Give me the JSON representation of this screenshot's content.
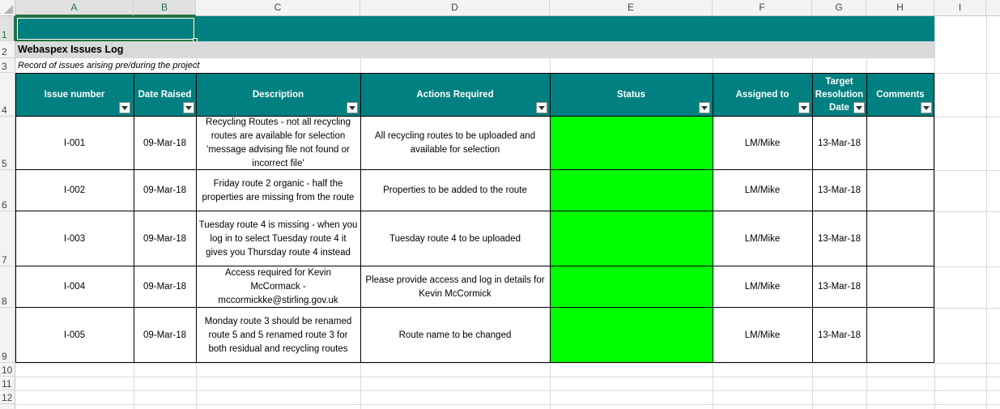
{
  "columns": [
    "A",
    "B",
    "C",
    "D",
    "E",
    "F",
    "G",
    "H",
    "I"
  ],
  "rows": [
    "1",
    "2",
    "3",
    "4",
    "5",
    "6",
    "7",
    "8",
    "9",
    "10",
    "11",
    "12"
  ],
  "title": "Webaspex Issues Log",
  "subtitle": "Record of issues arising pre/during the project",
  "headers": {
    "issue_number": "Issue number",
    "date_raised": "Date Raised",
    "description": "Description",
    "actions_required": "Actions Required",
    "status": "Status",
    "assigned_to": "Assigned to",
    "target_date": "Target Resolution Date",
    "comments": "Comments"
  },
  "issues": [
    {
      "id": "I-001",
      "date": "09-Mar-18",
      "description": "Recycling Routes - not all recycling routes are available for selection 'message advising file not found or incorrect file'",
      "actions": "All recycling routes to be uploaded and available for selection",
      "assigned": "LM/Mike",
      "target": "13-Mar-18",
      "comments": ""
    },
    {
      "id": "I-002",
      "date": "09-Mar-18",
      "description": "Friday route 2 organic - half the properties are missing from the route",
      "actions": "Properties to be added to the route",
      "assigned": "LM/Mike",
      "target": "13-Mar-18",
      "comments": ""
    },
    {
      "id": "I-003",
      "date": "09-Mar-18",
      "description": "Tuesday route 4 is missing - when you log in to select Tuesday route 4 it gives you Thursday route 4 instead",
      "actions": "Tuesday route 4 to be uploaded",
      "assigned": "LM/Mike",
      "target": "13-Mar-18",
      "comments": ""
    },
    {
      "id": "I-004",
      "date": "09-Mar-18",
      "description": "Access required for Kevin McCormack - mccormickke@stirling.gov.uk",
      "actions": "Please provide access and log in details for Kevin McCormick",
      "assigned": "LM/Mike",
      "target": "13-Mar-18",
      "comments": ""
    },
    {
      "id": "I-005",
      "date": "09-Mar-18",
      "description": "Monday route 3 should be renamed route 5 and 5 renamed route 3 for both residual and recycling routes",
      "actions": "Route name to be changed",
      "assigned": "LM/Mike",
      "target": "13-Mar-18",
      "comments": ""
    }
  ],
  "colors": {
    "header_teal": "#008080",
    "status_green": "#00ff00",
    "title_band": "#d9d9d9",
    "selection": "#217346"
  }
}
